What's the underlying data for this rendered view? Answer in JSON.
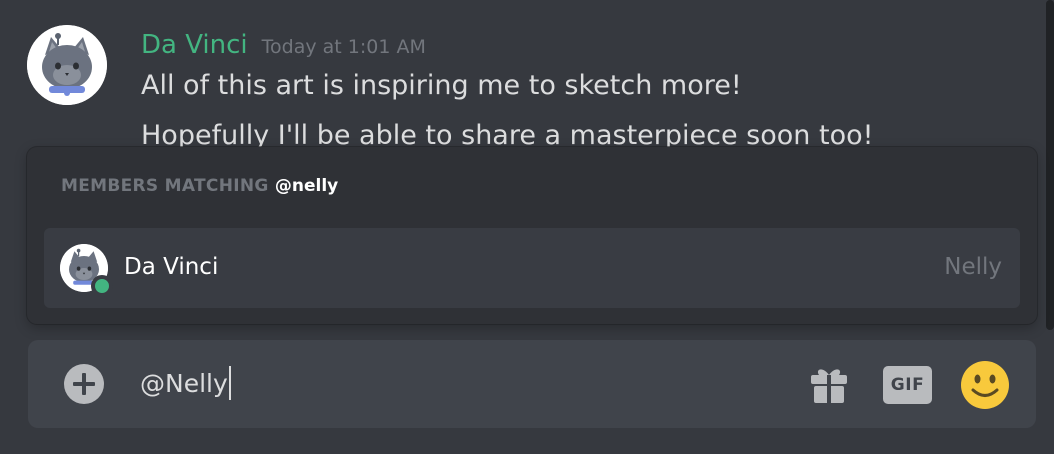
{
  "message": {
    "author": "Da Vinci",
    "timestamp": "Today at 1:01 AM",
    "lines": [
      "All of this art is inspiring me to sketch more!",
      "Hopefully I'll be able to share a masterpiece soon too!"
    ],
    "author_color": "#43b581",
    "avatar_icon": "gray-cat-avatar"
  },
  "autocomplete": {
    "header_prefix": "MEMBERS MATCHING",
    "header_query": "@nelly",
    "results": [
      {
        "name": "Da Vinci",
        "nickname": "Nelly",
        "status": "online",
        "status_color": "#43b581",
        "avatar_icon": "gray-cat-avatar"
      }
    ]
  },
  "input": {
    "value": "@Nelly",
    "attach_icon": "plus-circle-icon",
    "gift_icon": "gift-icon",
    "gif_label": "GIF",
    "emoji_icon": "smiley-emoji-icon"
  },
  "colors": {
    "background": "#36393f",
    "popup": "#2f3136",
    "input": "#40444b",
    "online": "#43b581"
  }
}
